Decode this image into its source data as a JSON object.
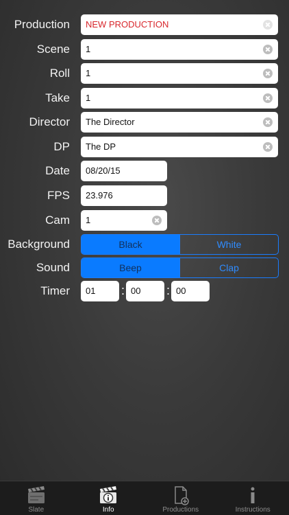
{
  "form": {
    "production": {
      "label": "Production",
      "value": "NEW PRODUCTION"
    },
    "scene": {
      "label": "Scene",
      "value": "1"
    },
    "roll": {
      "label": "Roll",
      "value": "1"
    },
    "take": {
      "label": "Take",
      "value": "1"
    },
    "director": {
      "label": "Director",
      "value": "The Director"
    },
    "dp": {
      "label": "DP",
      "value": "The DP"
    },
    "date": {
      "label": "Date",
      "value": "08/20/15"
    },
    "fps": {
      "label": "FPS",
      "value": "23.976"
    },
    "cam": {
      "label": "Cam",
      "value": "1"
    },
    "background": {
      "label": "Background",
      "options": [
        "Black",
        "White"
      ],
      "selected": "Black"
    },
    "sound": {
      "label": "Sound",
      "options": [
        "Beep",
        "Clap"
      ],
      "selected": "Beep"
    },
    "timer": {
      "label": "Timer",
      "hours": "01",
      "minutes": "00",
      "seconds": "00",
      "separator": ":"
    }
  },
  "tabbar": {
    "tabs": [
      {
        "label": "Slate",
        "icon": "clapperboard-icon"
      },
      {
        "label": "Info",
        "icon": "clapperboard-info-icon",
        "active": true
      },
      {
        "label": "Productions",
        "icon": "document-add-icon"
      },
      {
        "label": "Instructions",
        "icon": "info-icon"
      }
    ]
  },
  "colors": {
    "accent": "#0a7bff",
    "production_value": "#d8262b",
    "tabbar_bg": "#1c1c1c"
  }
}
